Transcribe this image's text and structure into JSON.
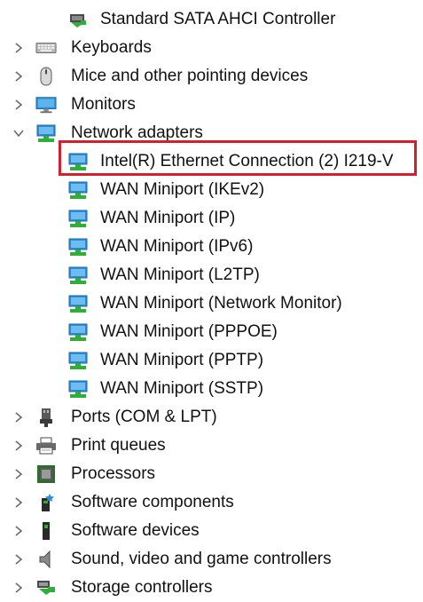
{
  "device_tree": {
    "items": [
      {
        "label": "Standard SATA AHCI Controller",
        "icon": "storage-controller-icon"
      },
      {
        "label": "Keyboards",
        "icon": "keyboard-icon"
      },
      {
        "label": "Mice and other pointing devices",
        "icon": "mouse-icon"
      },
      {
        "label": "Monitors",
        "icon": "monitor-icon"
      },
      {
        "label": "Network adapters",
        "icon": "network-adapter-icon"
      },
      {
        "label": "Intel(R) Ethernet Connection (2) I219-V",
        "icon": "network-adapter-icon"
      },
      {
        "label": "WAN Miniport (IKEv2)",
        "icon": "network-adapter-icon"
      },
      {
        "label": "WAN Miniport (IP)",
        "icon": "network-adapter-icon"
      },
      {
        "label": "WAN Miniport (IPv6)",
        "icon": "network-adapter-icon"
      },
      {
        "label": "WAN Miniport (L2TP)",
        "icon": "network-adapter-icon"
      },
      {
        "label": "WAN Miniport (Network Monitor)",
        "icon": "network-adapter-icon"
      },
      {
        "label": "WAN Miniport (PPPOE)",
        "icon": "network-adapter-icon"
      },
      {
        "label": "WAN Miniport (PPTP)",
        "icon": "network-adapter-icon"
      },
      {
        "label": "WAN Miniport (SSTP)",
        "icon": "network-adapter-icon"
      },
      {
        "label": "Ports (COM & LPT)",
        "icon": "port-icon"
      },
      {
        "label": "Print queues",
        "icon": "printer-icon"
      },
      {
        "label": "Processors",
        "icon": "processor-icon"
      },
      {
        "label": "Software components",
        "icon": "software-component-icon"
      },
      {
        "label": "Software devices",
        "icon": "software-device-icon"
      },
      {
        "label": "Sound, video and game controllers",
        "icon": "speaker-icon"
      },
      {
        "label": "Storage controllers",
        "icon": "storage-controller-icon"
      }
    ]
  },
  "colors": {
    "highlight": "#d4202c",
    "network_blue": "#2a8fd8",
    "network_green": "#2fae3a",
    "chevron": "#6b6b6b"
  }
}
